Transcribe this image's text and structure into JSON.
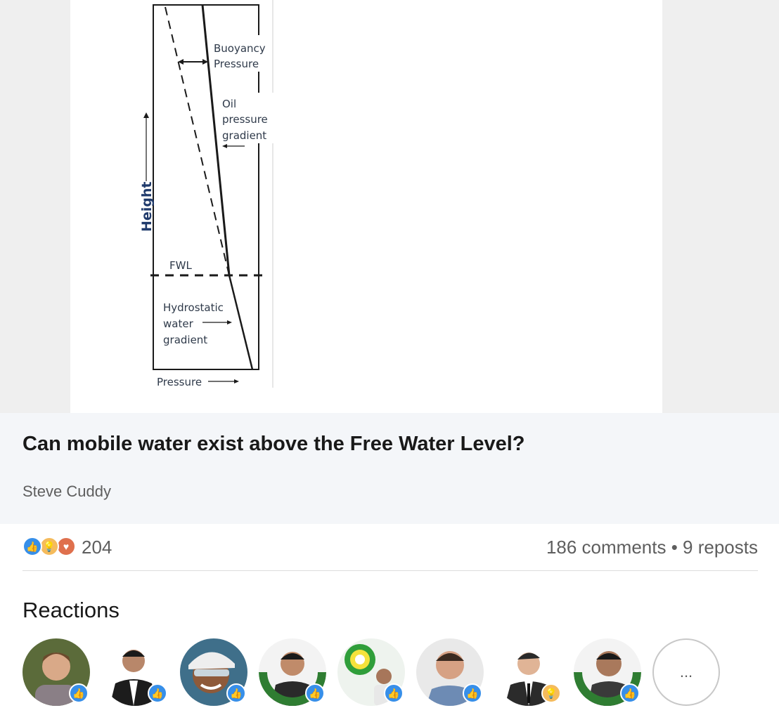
{
  "diagram": {
    "labels": {
      "buoyancy_1": "Buoyancy",
      "buoyancy_2": "Pressure",
      "oil_1": "Oil",
      "oil_2": "pressure",
      "oil_3": "gradient",
      "height": "Height",
      "fwl": "FWL",
      "hydro_1": "Hydrostatic",
      "hydro_2": "water",
      "hydro_3": "gradient",
      "pressure": "Pressure"
    },
    "colors": {
      "lines": "#1a1a1a",
      "axis_title": "#1f3a6b"
    }
  },
  "article": {
    "title": "Can mobile water exist above the Free Water Level?",
    "author": "Steve Cuddy"
  },
  "social": {
    "reaction_icons": [
      "like-icon",
      "insightful-icon",
      "love-icon"
    ],
    "reaction_count": "204",
    "comments": "186 comments",
    "separator": "•",
    "reposts": "9 reposts"
  },
  "reactions": {
    "title": "Reactions",
    "more_label": "...",
    "avatars": [
      {
        "reaction": "like"
      },
      {
        "reaction": "like"
      },
      {
        "reaction": "like"
      },
      {
        "reaction": "like",
        "frame": "#OPENTOWORK"
      },
      {
        "reaction": "like"
      },
      {
        "reaction": "like"
      },
      {
        "reaction": "insightful"
      },
      {
        "reaction": "like",
        "frame": "#OPENTOWORK"
      }
    ]
  }
}
